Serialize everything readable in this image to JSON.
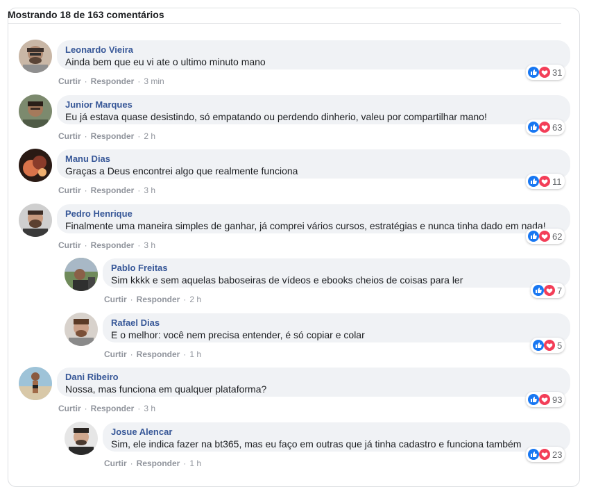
{
  "header": {
    "title": "Mostrando 18 de 163 comentários"
  },
  "actions": {
    "like_label": "Curtir",
    "reply_label": "Responder",
    "separator": "·"
  },
  "colors": {
    "author": "#385898",
    "bubble": "#f0f2f5",
    "like_blue": "#1877f2",
    "love_red": "#f33e58"
  },
  "comments": [
    {
      "author": "Leonardo Vieira",
      "text": "Ainda bem que eu vi ate o ultimo minuto mano",
      "time": "3 min",
      "reactions": "31"
    },
    {
      "author": "Junior Marques",
      "text": "Eu já estava quase desistindo, só empatando ou perdendo dinherio, valeu por compartilhar mano!",
      "time": "2 h",
      "reactions": "63"
    },
    {
      "author": "Manu Dias",
      "text": "Graças a Deus encontrei algo que realmente funciona",
      "time": "3 h",
      "reactions": "11"
    },
    {
      "author": "Pedro Henrique",
      "text": "Finalmente uma maneira simples de ganhar, já comprei vários cursos, estratégias e nunca tinha dado em nada!",
      "time": "3 h",
      "reactions": "62"
    },
    {
      "author": "Pablo Freitas",
      "text": "Sim kkkk e sem aquelas baboseiras de vídeos e ebooks cheios de coisas para ler",
      "time": "2 h",
      "reactions": "7"
    },
    {
      "author": "Rafael Dias",
      "text": "E o melhor: você nem precisa entender, é só copiar e colar",
      "time": "1 h",
      "reactions": "5"
    },
    {
      "author": "Dani Ribeiro",
      "text": "Nossa, mas funciona em qualquer plataforma?",
      "time": "3 h",
      "reactions": "93"
    },
    {
      "author": "Josue Alencar",
      "text": "Sim, ele indica fazer na bt365, mas eu faço em outras que já tinha cadastro e funciona também",
      "time": "1 h",
      "reactions": "23"
    }
  ]
}
